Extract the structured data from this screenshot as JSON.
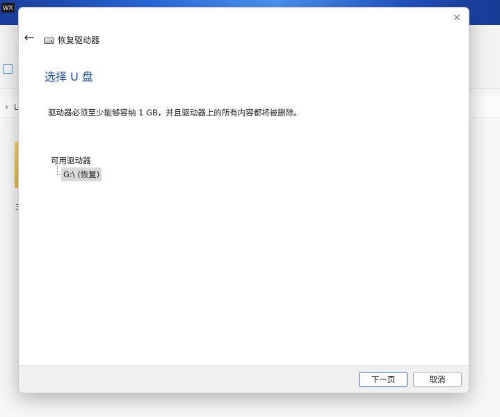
{
  "taskbar": {
    "label": "WX"
  },
  "explorer": {
    "address_partial": "L",
    "folder_label_partial": "主"
  },
  "dialog": {
    "window_title": "恢复驱动器",
    "heading": "选择 U 盘",
    "instruction": "驱动器必须至少能够容纳 1 GB，并且驱动器上的所有内容都将被删除。",
    "drives_label": "可用驱动器",
    "drives": [
      {
        "label": "G:\\ (恢复)",
        "selected": true
      }
    ],
    "buttons": {
      "next": "下一页",
      "cancel": "取消"
    },
    "icons": {
      "close": "close-icon",
      "back": "back-arrow-icon",
      "drive": "drive-icon"
    },
    "colors": {
      "heading": "#1a4fa8",
      "primary_button_border": "#2f6fd2",
      "selected_item_bg": "#d9d9d9"
    }
  }
}
